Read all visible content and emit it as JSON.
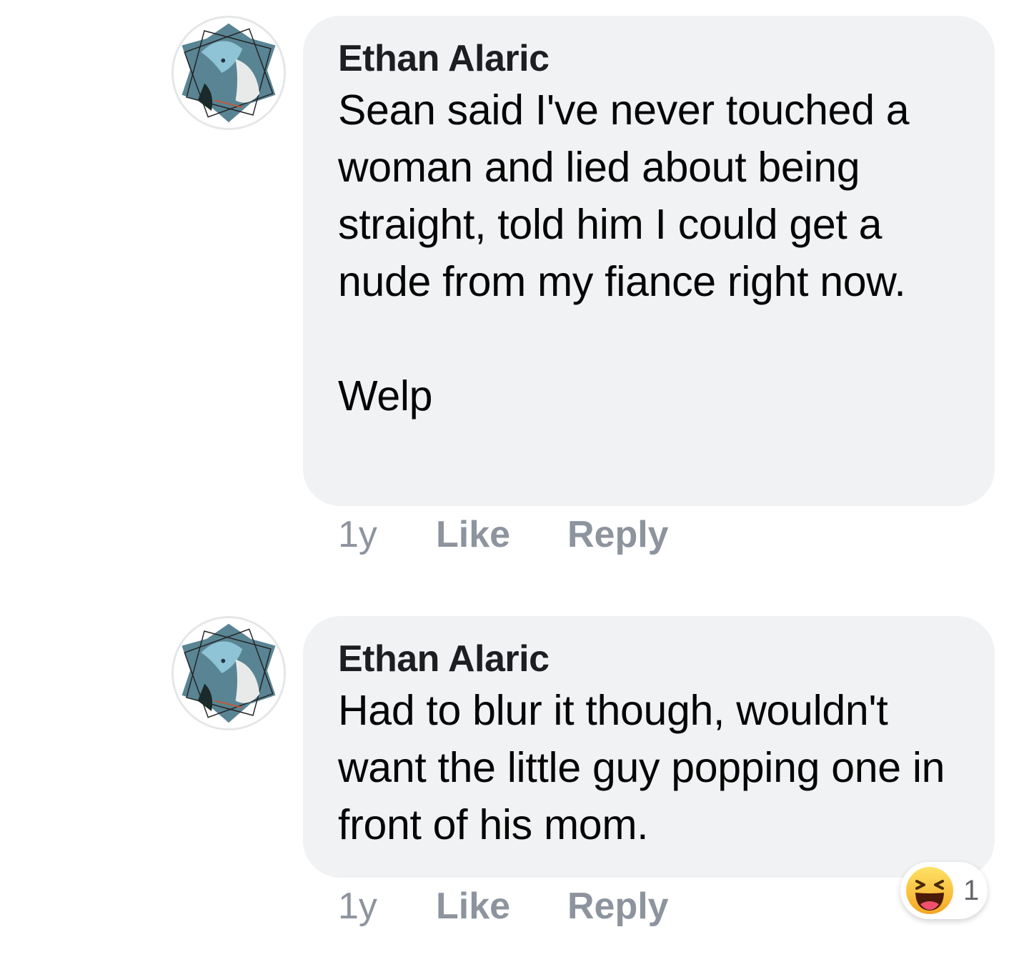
{
  "comments": [
    {
      "author": "Ethan Alaric",
      "text": "Sean said I've never touched a woman and lied about being straight, told him I could get a nude from my fiance right now.\n\nWelp",
      "time": "1y",
      "like_label": "Like",
      "reply_label": "Reply"
    },
    {
      "author": "Ethan Alaric",
      "text": "Had to blur it though, wouldn't want the little guy popping one in front of his mom.",
      "time": "1y",
      "like_label": "Like",
      "reply_label": "Reply",
      "reaction": {
        "icon": "haha-reaction-icon",
        "count": "1"
      }
    }
  ],
  "colors": {
    "bubble_bg": "#f1f2f4",
    "meta_text": "#8d949e",
    "author_text": "#1c1e21"
  }
}
